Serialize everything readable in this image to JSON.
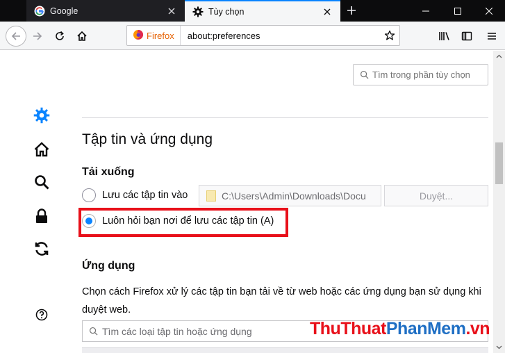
{
  "tabs": [
    {
      "label": "Google",
      "icon": "google-g-icon"
    },
    {
      "label": "Tùy chọn",
      "icon": "gear-icon",
      "active": true
    }
  ],
  "navbar": {
    "identity_label": "Firefox",
    "url": "about:preferences"
  },
  "sidebar": {
    "items": [
      {
        "name": "general",
        "icon": "gear-icon",
        "selected": true
      },
      {
        "name": "home",
        "icon": "home-icon"
      },
      {
        "name": "search",
        "icon": "search-icon"
      },
      {
        "name": "privacy",
        "icon": "lock-icon"
      },
      {
        "name": "sync",
        "icon": "sync-icon"
      }
    ],
    "help_icon": "help-icon"
  },
  "search": {
    "placeholder": "Tìm trong phần tùy chọn"
  },
  "content": {
    "section_title": "Tập tin và ứng dụng",
    "downloads": {
      "title": "Tải xuống",
      "save_to_label": "Lưu các tập tin vào",
      "save_path": "C:\\Users\\Admin\\Downloads\\Docu",
      "browse_label": "Duyệt...",
      "always_ask_label": "Luôn hỏi bạn nơi để lưu các tập tin (A)",
      "selected": "always_ask"
    },
    "applications": {
      "title": "Ứng dụng",
      "description": "Chọn cách Firefox xử lý các tập tin bạn tải về từ web hoặc các ứng dụng bạn sử dụng khi duyệt web.",
      "filter_placeholder": "Tìm các loại tập tin hoặc ứng dụng"
    }
  },
  "watermark": {
    "part1": "ThuThuat",
    "part2": "PhanMem",
    "part3": ".vn"
  },
  "colors": {
    "accent": "#0a84ff",
    "highlight": "#e8101a",
    "firefox_orange": "#e66000"
  }
}
